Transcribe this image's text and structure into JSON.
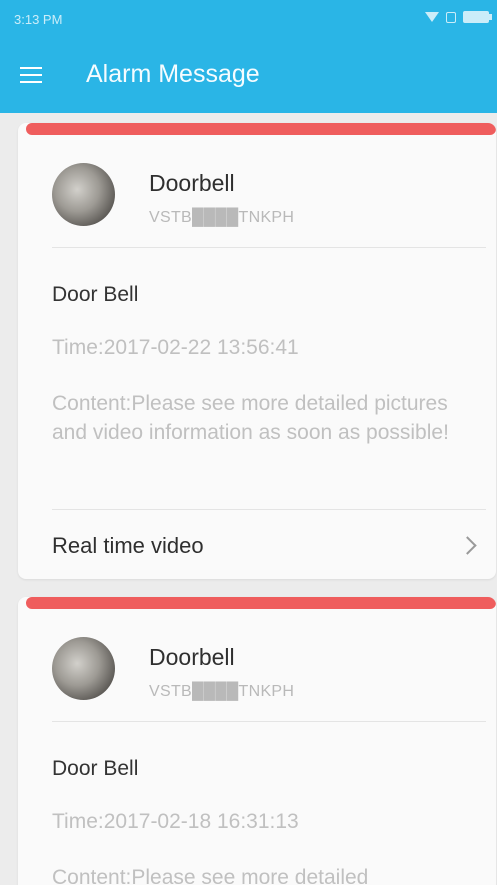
{
  "status_bar": {
    "time": "3:13 PM",
    "icons": [
      "wifi-icon",
      "sim-icon",
      "battery-icon"
    ]
  },
  "app_bar": {
    "title": "Alarm Message",
    "menu_icon": "hamburger-menu-icon"
  },
  "colors": {
    "header": "#2ab5e6",
    "alert_stripe": "#ef5d5d",
    "background": "#ececec"
  },
  "messages": [
    {
      "device_name": "Doorbell",
      "device_id": "VSTB████TNKPH",
      "event": "Door Bell",
      "time": "Time:2017-02-22 13:56:41",
      "content": "Content:Please see more detailed pictures and video information as soon as possible!",
      "action_label": "Real time video"
    },
    {
      "device_name": "Doorbell",
      "device_id": "VSTB████TNKPH",
      "event": "Door Bell",
      "time": "Time:2017-02-18 16:31:13",
      "content": "Content:Please see more detailed"
    }
  ]
}
